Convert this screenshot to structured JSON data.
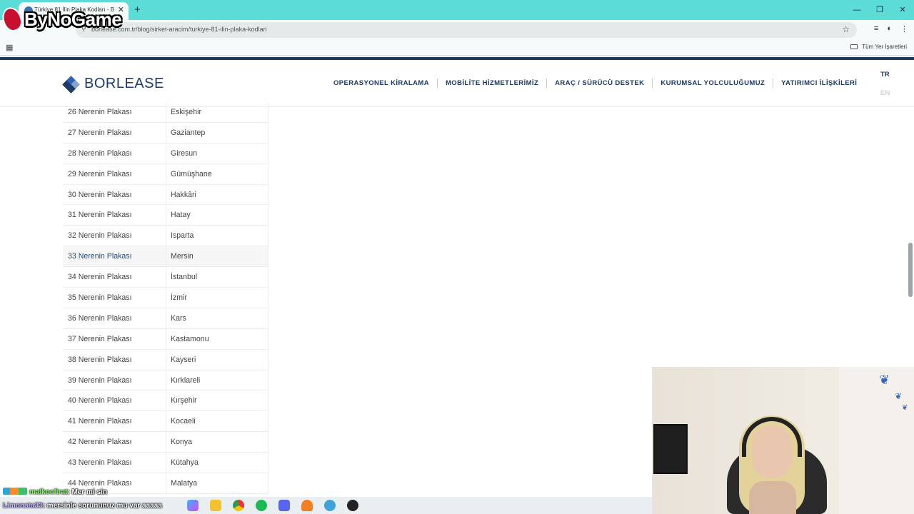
{
  "browser": {
    "tab_title": "Türkiye 81 İlin Plaka Kodları - B",
    "tab_close": "✕",
    "new_tab": "+",
    "url": "borlease.com.tr/blog/sirket-aracim/turkiye-81-ilin-plaka-kodlari",
    "star": "☆",
    "window_controls": [
      "—",
      "❐",
      "✕"
    ],
    "bookmarks_all": "Tüm Yer İşaretleri"
  },
  "site": {
    "logo_text": "BORLEASE",
    "nav": [
      "OPERASYONEL KİRALAMA",
      "MOBİLİTE HİZMETLERİMİZ",
      "ARAÇ / SÜRÜCÜ DESTEK",
      "KURUMSAL YOLCULUĞUMUZ",
      "YATIRIMCI İLİŞKİLERİ"
    ],
    "lang_active": "TR",
    "lang_inactive": "EN",
    "colors": {
      "brand_navy": "#1d3b6a",
      "logo_blue": "#2a63b8"
    }
  },
  "table": {
    "rows": [
      [
        "26 Nerenin Plakası",
        "Eskişehir"
      ],
      [
        "27 Nerenin Plakası",
        "Gaziantep"
      ],
      [
        "28 Nerenin Plakası",
        "Giresun"
      ],
      [
        "29 Nerenin Plakası",
        "Gümüşhane"
      ],
      [
        "30 Nerenin Plakası",
        "Hakkâri"
      ],
      [
        "31 Nerenin Plakası",
        "Hatay"
      ],
      [
        "32 Nerenin Plakası",
        "Isparta"
      ],
      [
        "33 Nerenin Plakası",
        "Mersin"
      ],
      [
        "34 Nerenin Plakası",
        "İstanbul"
      ],
      [
        "35 Nerenin Plakası",
        "İzmir"
      ],
      [
        "36 Nerenin Plakası",
        "Kars"
      ],
      [
        "37 Nerenin Plakası",
        "Kastamonu"
      ],
      [
        "38 Nerenin Plakası",
        "Kayseri"
      ],
      [
        "39 Nerenin Plakası",
        "Kırklareli"
      ],
      [
        "40 Nerenin Plakası",
        "Kırşehir"
      ],
      [
        "41 Nerenin Plakası",
        "Kocaeli"
      ],
      [
        "42 Nerenin Plakası",
        "Konya"
      ],
      [
        "43 Nerenin Plakası",
        "Kütahya"
      ],
      [
        "44 Nerenin Plakası",
        "Malatya"
      ]
    ],
    "hovered_row_index": 7
  },
  "overlay": {
    "brand": "ByNoGame",
    "chat": [
      {
        "user": "malkocfirat",
        "message": ": Mer mi sin"
      },
      {
        "user": "Limonata33",
        "message": ": mersinle sorununuz mu var aaaaa"
      }
    ]
  }
}
